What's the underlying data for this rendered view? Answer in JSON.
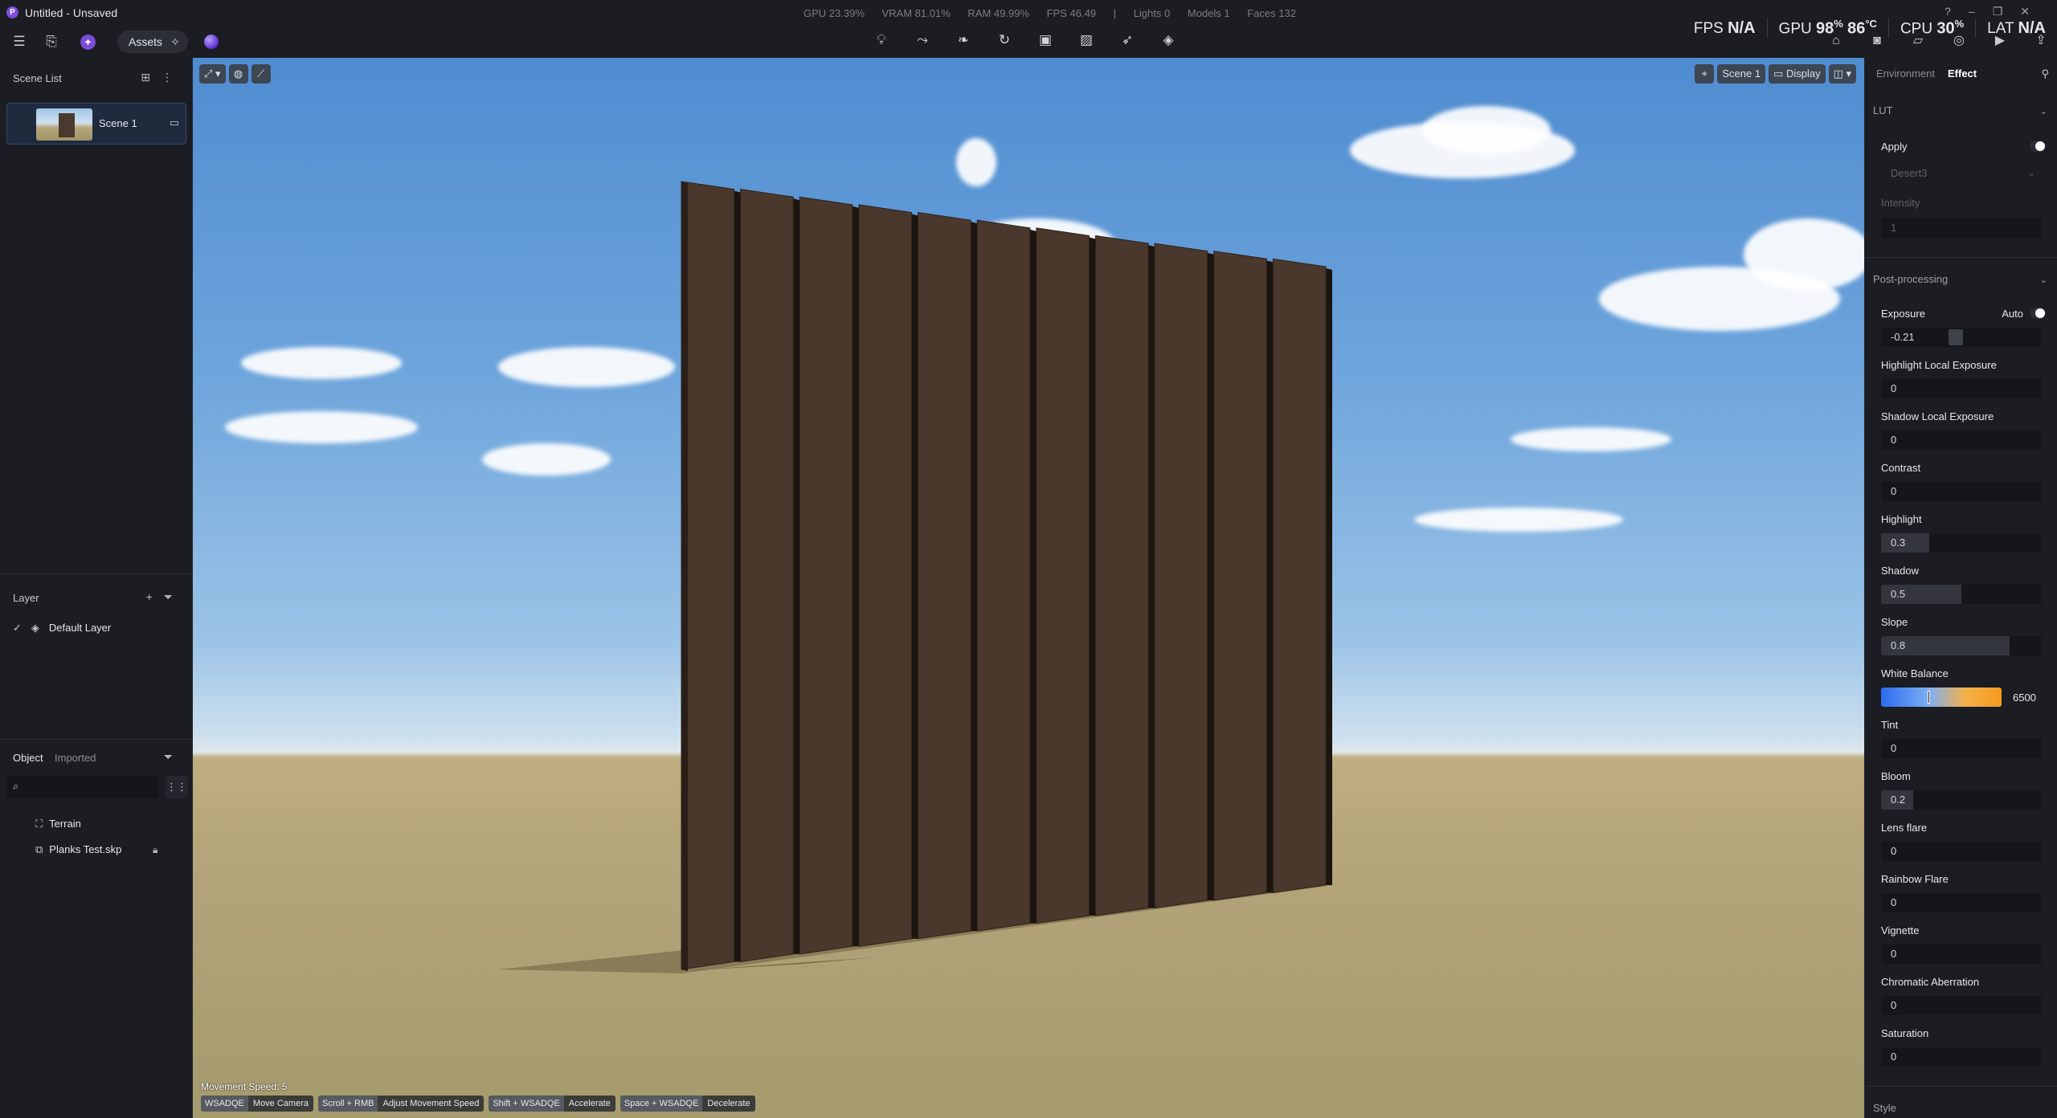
{
  "window": {
    "title": "Untitled - Unsaved",
    "logo": "P",
    "controls": [
      "?",
      "–",
      "❐",
      "✕"
    ]
  },
  "stats": {
    "gpu": "GPU 23.39%",
    "vram": "VRAM 81.01%",
    "ram": "RAM 49.99%",
    "fps": "FPS 46.49",
    "sep": "|",
    "lights": "Lights 0",
    "models": "Models 1",
    "faces": "Faces 132"
  },
  "monitors": {
    "fps_label": "FPS",
    "fps_value": "N/A",
    "gpu_label": "GPU",
    "gpu_value": "98",
    "gpu_unit": "%",
    "gpu_temp": "86",
    "gpu_temp_unit": "°C",
    "cpu_label": "CPU",
    "cpu_value": "30",
    "cpu_unit": "%",
    "lat_label": "LAT",
    "lat_value": "N/A"
  },
  "toolbar": {
    "assets_label": "Assets"
  },
  "left": {
    "scene_list_title": "Scene List",
    "scene_name": "Scene 1",
    "layer_title": "Layer",
    "layer_name": "Default Layer",
    "tab_object": "Object",
    "tab_imported": "Imported",
    "search_placeholder": "",
    "objects": [
      "Terrain",
      "Planks Test.skp"
    ]
  },
  "viewport": {
    "scene_btn": "Scene 1",
    "display_btn": "Display",
    "movement_speed": "Movement Speed: 5",
    "hints": [
      {
        "key": "WSADQE",
        "desc": "Move Camera"
      },
      {
        "key": "Scroll + RMB",
        "desc": "Adjust Movement Speed"
      },
      {
        "key": "Shift + WSADQE",
        "desc": "Accelerate"
      },
      {
        "key": "Space + WSADQE",
        "desc": "Decelerate"
      }
    ]
  },
  "right": {
    "tab_environment": "Environment",
    "tab_effect": "Effect",
    "lut": {
      "title": "LUT",
      "apply_label": "Apply",
      "preset": "Desert3",
      "intensity_label": "Intensity",
      "intensity_value": "1"
    },
    "post": {
      "title": "Post-processing",
      "exposure_label": "Exposure",
      "auto_label": "Auto",
      "exposure_value": "-0.21",
      "hle_label": "Highlight Local Exposure",
      "hle_value": "0",
      "sle_label": "Shadow Local Exposure",
      "sle_value": "0",
      "contrast_label": "Contrast",
      "contrast_value": "0",
      "highlight_label": "Highlight",
      "highlight_value": "0.3",
      "shadow_label": "Shadow",
      "shadow_value": "0.5",
      "slope_label": "Slope",
      "slope_value": "0.8",
      "wb_label": "White Balance",
      "wb_value": "6500",
      "tint_label": "Tint",
      "tint_value": "0",
      "bloom_label": "Bloom",
      "bloom_value": "0.2",
      "lens_label": "Lens flare",
      "lens_value": "0",
      "rainbow_label": "Rainbow Flare",
      "rainbow_value": "0",
      "vignette_label": "Vignette",
      "vignette_value": "0",
      "chroma_label": "Chromatic Aberration",
      "chroma_value": "0",
      "saturation_label": "Saturation",
      "saturation_value": "0"
    },
    "style_title": "Style"
  },
  "colors": {
    "accent": "#7b4dd6",
    "panel": "#1b1d22",
    "field": "#14161a",
    "plank": "#4a382c"
  }
}
